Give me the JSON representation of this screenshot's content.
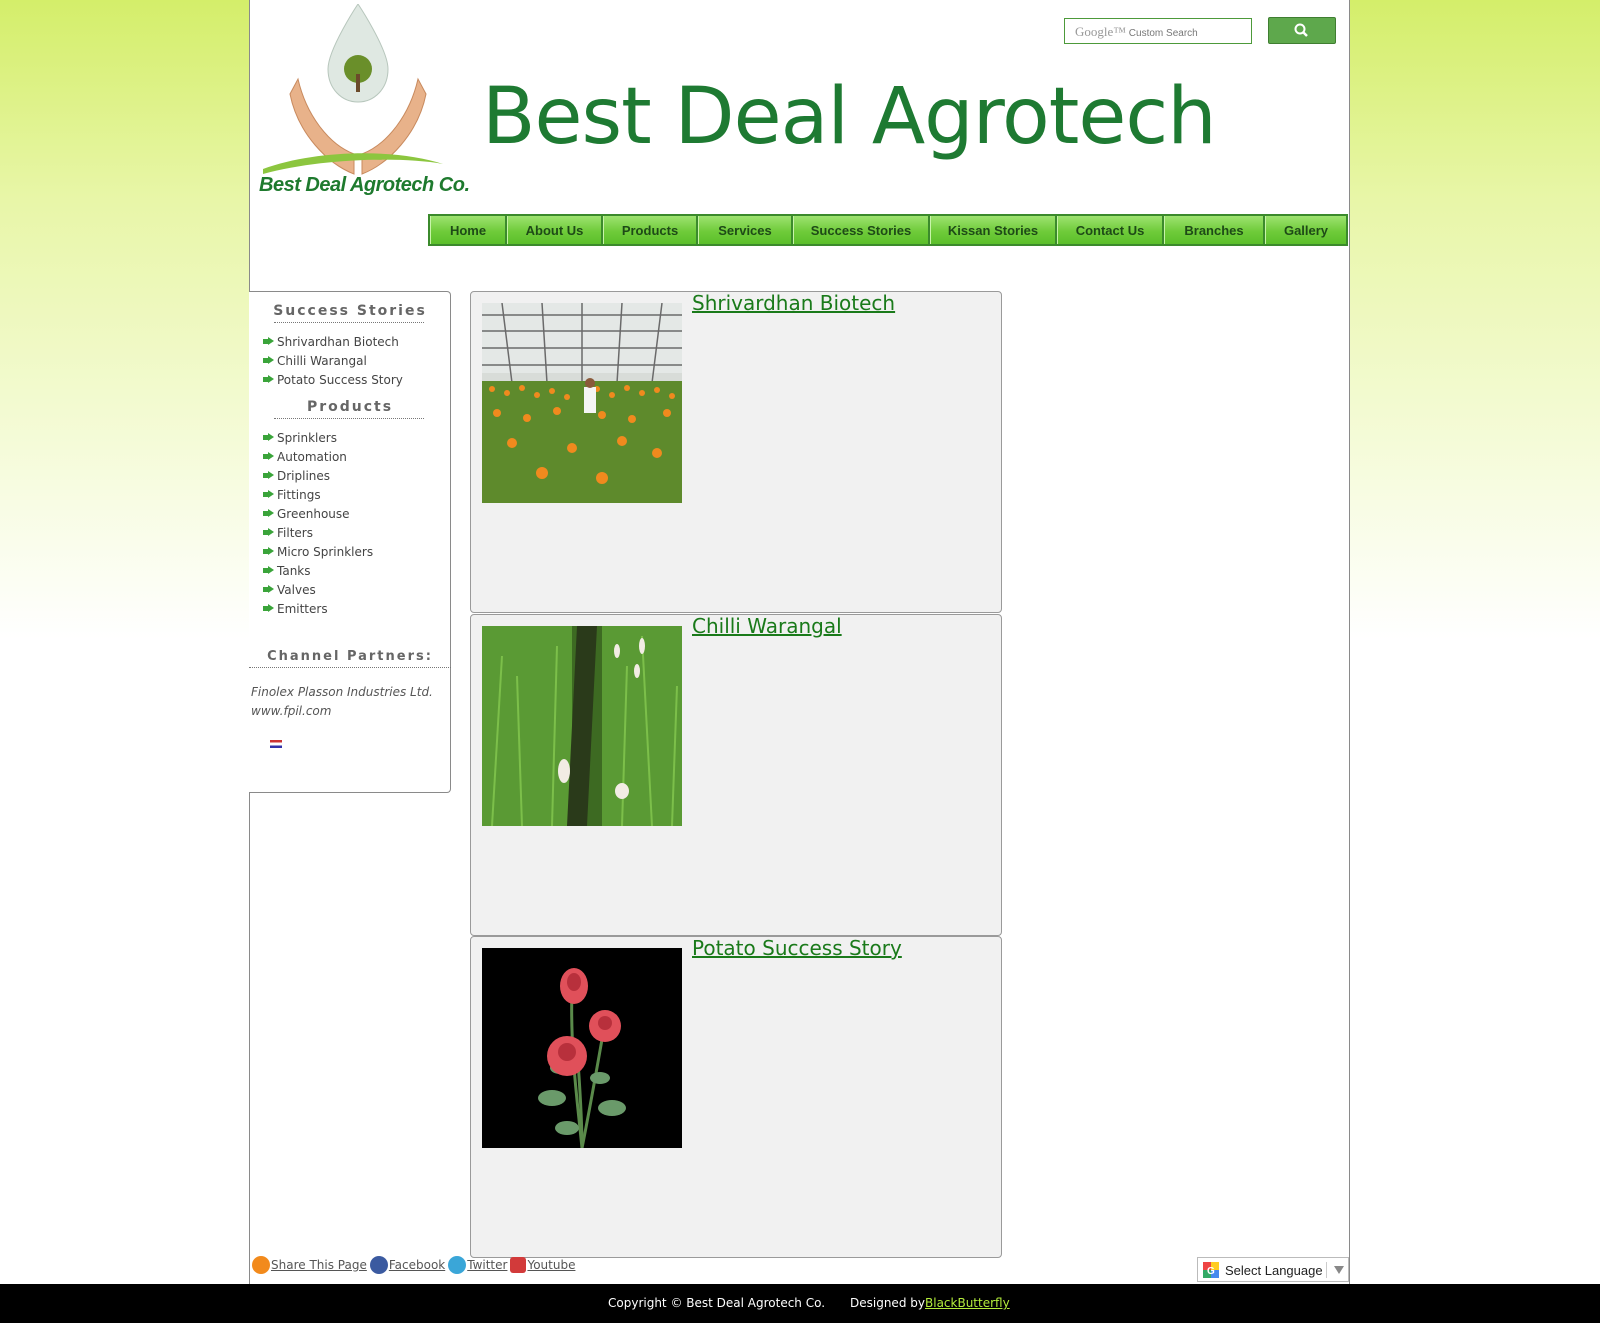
{
  "header": {
    "site_title": "Best Deal Agrotech",
    "logo_text": "Best Deal Agrotech Co."
  },
  "search": {
    "placeholder_brand": "Google™",
    "placeholder": "Custom Search"
  },
  "nav": {
    "items": [
      {
        "label": "Home"
      },
      {
        "label": "About Us"
      },
      {
        "label": "Products"
      },
      {
        "label": "Services"
      },
      {
        "label": "Success Stories"
      },
      {
        "label": "Kissan Stories"
      },
      {
        "label": "Contact Us"
      },
      {
        "label": "Branches"
      },
      {
        "label": "Gallery"
      }
    ]
  },
  "sidebar": {
    "success_heading": "Success Stories",
    "success_items": [
      "Shrivardhan Biotech",
      "Chilli Warangal",
      "Potato Success Story"
    ],
    "products_heading": "Products",
    "product_items": [
      "Sprinklers",
      "Automation",
      "Driplines",
      "Fittings",
      "Greenhouse",
      "Filters",
      "Micro Sprinklers",
      "Tanks",
      "Valves",
      "Emitters"
    ],
    "partners_heading": "Channel Partners:",
    "partner_name": "Finolex Plasson Industries Ltd.",
    "partner_url": "www.fpil.com"
  },
  "stories": [
    {
      "title": "Shrivardhan Biotech"
    },
    {
      "title": "Chilli Warangal"
    },
    {
      "title": "Potato Success Story"
    }
  ],
  "share": {
    "share_label": "Share This Page",
    "facebook": "Facebook",
    "twitter": "Twitter",
    "youtube": "Youtube"
  },
  "language": {
    "label": "Select Language"
  },
  "footer": {
    "copyright": "Copyright © Best Deal Agrotech Co.",
    "designed_by": "Designed by",
    "designer": "BlackButterfly"
  },
  "colors": {
    "brand_green": "#1e7a32",
    "nav_green": "#6fcb3a",
    "link_green": "#1a7a1a",
    "footer_bg": "#000000"
  }
}
